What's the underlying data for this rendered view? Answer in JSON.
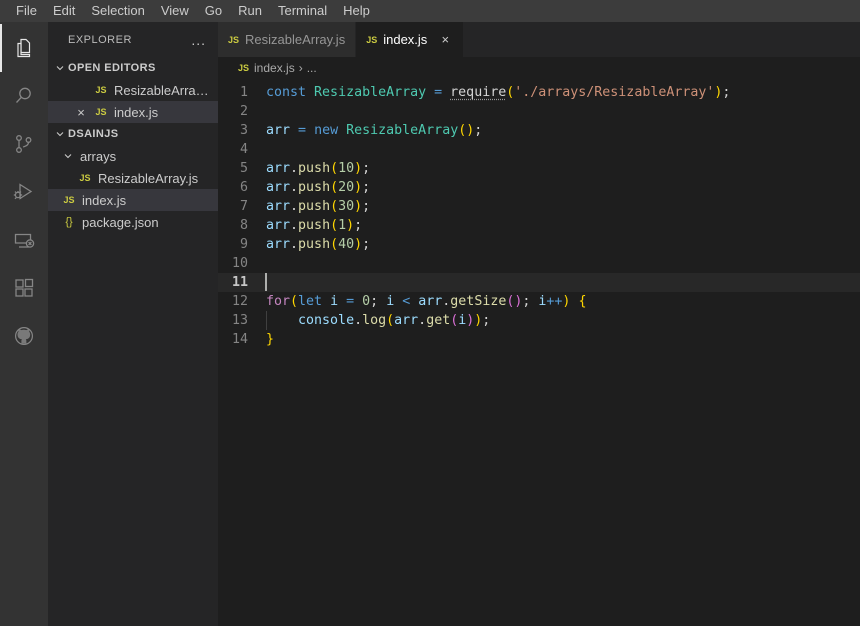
{
  "menubar": {
    "items": [
      {
        "label": "File"
      },
      {
        "label": "Edit"
      },
      {
        "label": "Selection"
      },
      {
        "label": "View"
      },
      {
        "label": "Go"
      },
      {
        "label": "Run"
      },
      {
        "label": "Terminal"
      },
      {
        "label": "Help"
      }
    ]
  },
  "activitybar": {
    "items": [
      {
        "name": "explorer",
        "icon": "files-icon",
        "active": true
      },
      {
        "name": "search",
        "icon": "search-icon",
        "active": false
      },
      {
        "name": "source-control",
        "icon": "source-control-icon",
        "active": false
      },
      {
        "name": "run-and-debug",
        "icon": "run-debug-icon",
        "active": false
      },
      {
        "name": "remote-explorer",
        "icon": "remote-explorer-icon",
        "active": false
      },
      {
        "name": "extensions",
        "icon": "extensions-icon",
        "active": false
      },
      {
        "name": "github",
        "icon": "github-icon",
        "active": false
      }
    ]
  },
  "sidebar": {
    "title": "EXPLORER",
    "more_actions": "...",
    "open_editors": {
      "label": "OPEN EDITORS",
      "expanded": true,
      "items": [
        {
          "label": "ResizableArray....",
          "icon": "js-file-icon",
          "badge": "JS",
          "selected": false,
          "show_close": false
        },
        {
          "label": "index.js",
          "icon": "js-file-icon",
          "badge": "JS",
          "selected": true,
          "show_close": true,
          "close_label": "×"
        }
      ]
    },
    "workspace": {
      "label": "DSAINJS",
      "expanded": true,
      "items": [
        {
          "label": "arrays",
          "type": "folder",
          "expanded": true,
          "depth": 1,
          "selected": false
        },
        {
          "label": "ResizableArray.js",
          "type": "file",
          "badge": "JS",
          "depth": 2,
          "selected": false
        },
        {
          "label": "index.js",
          "type": "file",
          "badge": "JS",
          "depth": 1,
          "selected": true
        },
        {
          "label": "package.json",
          "type": "file",
          "badge": "{}",
          "depth": 1,
          "selected": false
        }
      ]
    }
  },
  "editor": {
    "tabs": [
      {
        "label": "ResizableArray.js",
        "badge": "JS",
        "active": false,
        "show_close": false
      },
      {
        "label": "index.js",
        "badge": "JS",
        "active": true,
        "show_close": true,
        "close_label": "×"
      }
    ],
    "breadcrumb": {
      "badge": "JS",
      "file": "index.js",
      "separator": "›",
      "tail": "..."
    },
    "active_line": 11,
    "lines": [
      {
        "n": "1",
        "text": "const ResizableArray = require('./arrays/ResizableArray');"
      },
      {
        "n": "2",
        "text": ""
      },
      {
        "n": "3",
        "text": "arr = new ResizableArray();"
      },
      {
        "n": "4",
        "text": ""
      },
      {
        "n": "5",
        "text": "arr.push(10);"
      },
      {
        "n": "6",
        "text": "arr.push(20);"
      },
      {
        "n": "7",
        "text": "arr.push(30);"
      },
      {
        "n": "8",
        "text": "arr.push(1);"
      },
      {
        "n": "9",
        "text": "arr.push(40);"
      },
      {
        "n": "10",
        "text": ""
      },
      {
        "n": "11",
        "text": ""
      },
      {
        "n": "12",
        "text": "for(let i = 0; i < arr.getSize(); i++) {"
      },
      {
        "n": "13",
        "text": "    console.log(arr.get(i));"
      },
      {
        "n": "14",
        "text": "}"
      }
    ]
  },
  "colors": {
    "menubar_bg": "#3c3c3c",
    "activitybar_bg": "#333333",
    "sidebar_bg": "#252526",
    "editor_bg": "#1e1e1e",
    "tab_inactive_bg": "#2d2d2d",
    "selection_bg": "#37373d",
    "keyword": "#569cd6",
    "control": "#c586c0",
    "type": "#4ec9b0",
    "variable": "#9cdcfe",
    "function": "#dcdcaa",
    "string": "#ce9178",
    "number": "#b5cea8",
    "js_icon": "#cbcb41"
  }
}
